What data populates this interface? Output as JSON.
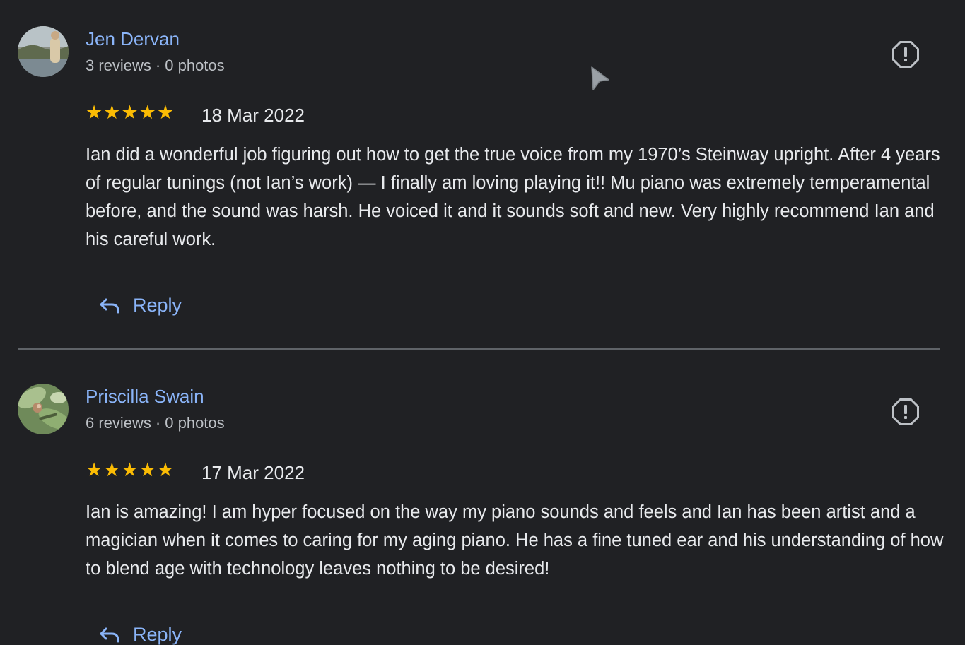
{
  "reviews": [
    {
      "name": "Jen Dervan",
      "reviews_count": "3 reviews",
      "separator": "·",
      "photos_count": "0 photos",
      "stars": "★★★★★",
      "rating": 5,
      "date": "18 Mar 2022",
      "text": "Ian did a wonderful job figuring out how to get the true voice from my 1970’s Steinway upright. After 4 years of regular tunings (not Ian’s work) — I finally am loving playing it!! Mu piano was extremely temperamental before, and the sound was harsh. He voiced it and it sounds soft and new. Very highly recommend Ian and his careful work.",
      "reply_label": "Reply"
    },
    {
      "name": "Priscilla Swain",
      "reviews_count": "6 reviews",
      "separator": "·",
      "photos_count": "0 photos",
      "stars": "★★★★★",
      "rating": 5,
      "date": "17 Mar 2022",
      "text": "Ian is amazing! I am hyper focused on the way my piano sounds and feels and Ian has been artist and a magician when it comes to caring for my aging piano. He has a fine tuned ear and his understanding of how to blend age with technology leaves nothing to be desired!",
      "reply_label": "Reply"
    }
  ],
  "icons": {
    "flag": "report-flag-icon",
    "reply": "reply-arrow-icon",
    "star": "star-icon",
    "cursor": "mouse-pointer-icon"
  },
  "colors": {
    "background": "#202124",
    "name_link": "#8ab4f8",
    "star": "#fbbc04",
    "body_text": "#e8eaed",
    "meta_text": "#bdc1c6",
    "divider": "#5f6368"
  }
}
